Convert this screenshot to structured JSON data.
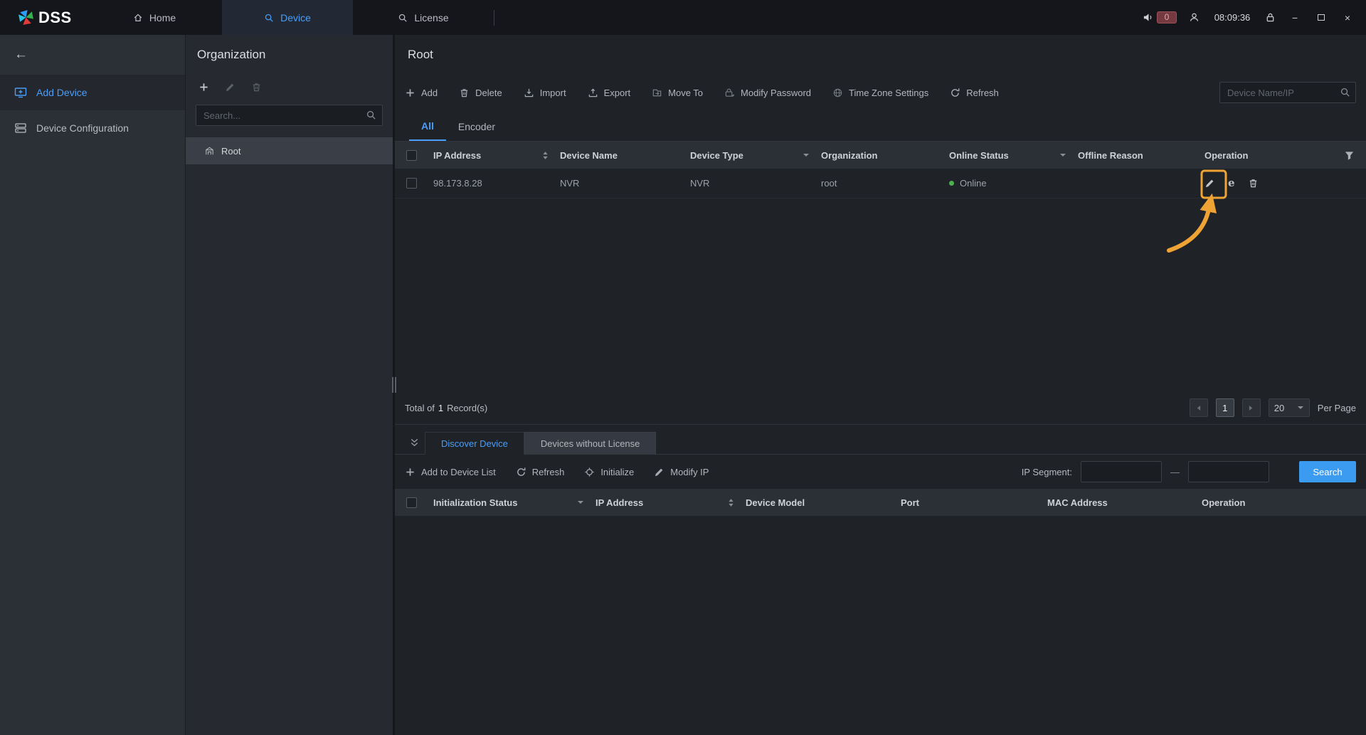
{
  "colors": {
    "accent_blue": "#4b9ef7",
    "online_green": "#4caf50",
    "annotation_orange": "#f0a335",
    "search_button_blue": "#3a9bf0",
    "badge_red": "#753a40"
  },
  "icons": {
    "back_arrow": "←",
    "minimize": "−",
    "close": "×",
    "web_browser": "e",
    "range_dash": "—"
  },
  "topbar": {
    "logo_text": "DSS",
    "tabs": [
      {
        "label": "Home"
      },
      {
        "label": "Device"
      },
      {
        "label": "License"
      }
    ],
    "notification_count": "0",
    "time": "08:09:36"
  },
  "sidebar": {
    "items": [
      {
        "label": "Add Device"
      },
      {
        "label": "Device Configuration"
      }
    ]
  },
  "organization": {
    "title": "Organization",
    "search_placeholder": "Search...",
    "tree": [
      {
        "label": "Root"
      }
    ]
  },
  "main": {
    "title": "Root",
    "toolbar": [
      {
        "label": "Add"
      },
      {
        "label": "Delete"
      },
      {
        "label": "Import"
      },
      {
        "label": "Export"
      },
      {
        "label": "Move To"
      },
      {
        "label": "Modify Password"
      },
      {
        "label": "Time Zone Settings"
      },
      {
        "label": "Refresh"
      }
    ],
    "search_placeholder": "Device Name/IP",
    "tabs": [
      {
        "label": "All"
      },
      {
        "label": "Encoder"
      }
    ],
    "table": {
      "headers": [
        "IP Address",
        "Device Name",
        "Device Type",
        "Organization",
        "Online Status",
        "Offline Reason",
        "Operation"
      ],
      "rows": [
        {
          "ip": "98.173.8.28",
          "device_name": "NVR",
          "device_type": "NVR",
          "organization": "root",
          "online_status": "Online",
          "offline_reason": ""
        }
      ]
    },
    "footer": {
      "total_prefix": "Total of",
      "total_count": "1",
      "total_suffix": "Record(s)",
      "current_page": "1",
      "per_page_value": "20",
      "per_page_label": "Per Page"
    }
  },
  "discover": {
    "tabs": [
      {
        "label": "Discover Device"
      },
      {
        "label": "Devices without License"
      }
    ],
    "toolbar": [
      {
        "label": "Add to Device List"
      },
      {
        "label": "Refresh"
      },
      {
        "label": "Initialize"
      },
      {
        "label": "Modify IP"
      }
    ],
    "ip_segment_label": "IP Segment:",
    "search_button": "Search",
    "table": {
      "headers": [
        "Initialization Status",
        "IP Address",
        "Device Model",
        "Port",
        "MAC Address",
        "Operation"
      ]
    }
  }
}
